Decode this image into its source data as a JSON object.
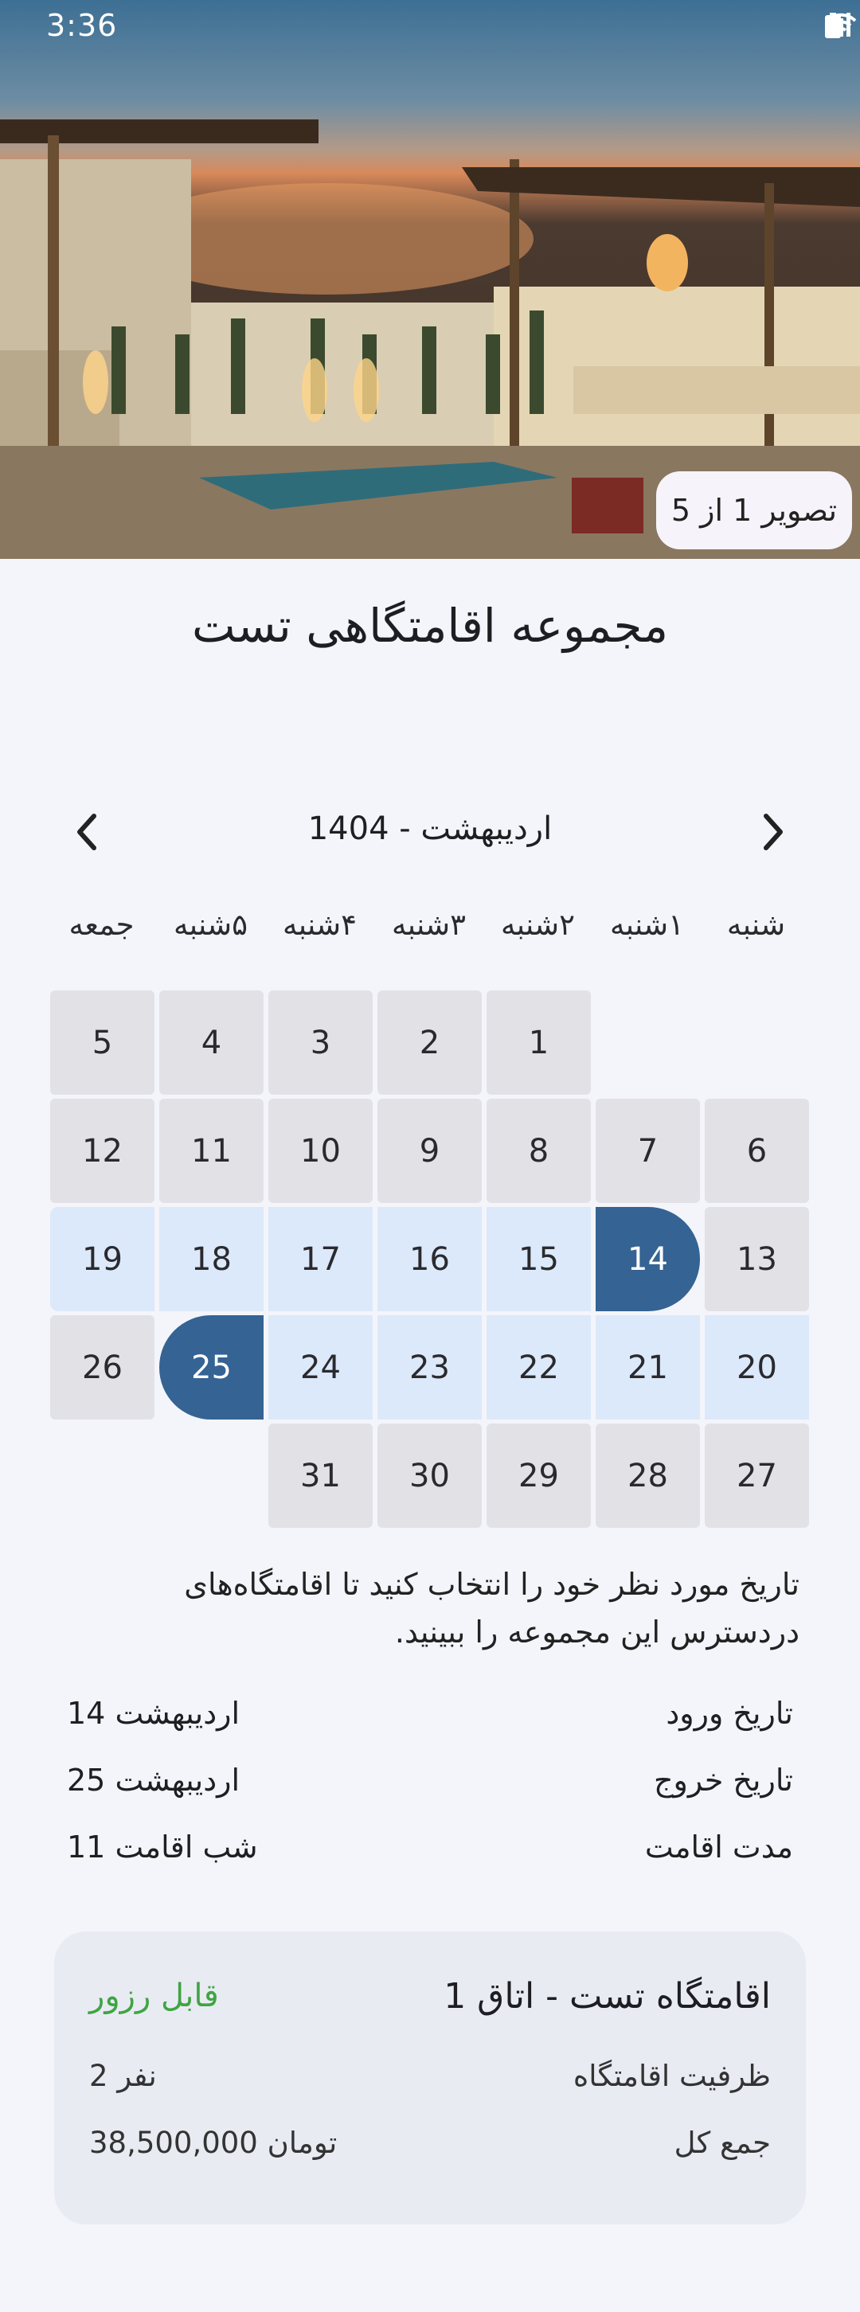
{
  "status_bar": {
    "time": "3:36"
  },
  "gallery": {
    "counter": "تصویر 1 از 5"
  },
  "title": "مجموعه اقامتگاهی تست",
  "calendar": {
    "month_label": "اردیبهشت - 1404",
    "weekdays": [
      "شنبه",
      "۱شنبه",
      "۲شنبه",
      "۳شنبه",
      "۴شنبه",
      "۵شنبه",
      "جمعه"
    ],
    "days": [
      "1",
      "2",
      "3",
      "4",
      "5",
      "6",
      "7",
      "8",
      "9",
      "10",
      "11",
      "12",
      "13",
      "14",
      "15",
      "16",
      "17",
      "18",
      "19",
      "20",
      "21",
      "22",
      "23",
      "24",
      "25",
      "26",
      "27",
      "28",
      "29",
      "30",
      "31"
    ],
    "check_in_day": 14,
    "check_out_day": 25,
    "colors": {
      "selected": "#356393",
      "range": "#dce9fa",
      "default": "#e2e2e6"
    }
  },
  "hint": "تاریخ مورد نظر خود را انتخاب کنید تا اقامتگاه‌های دردسترس این مجموعه را ببینید.",
  "summary": {
    "check_in_label": "تاریخ ورود",
    "check_in_value": "14 اردیبهشت",
    "check_out_label": "تاریخ خروج",
    "check_out_value": "25 اردیبهشت",
    "stay_label": "مدت اقامت",
    "stay_value": "11 شب اقامت"
  },
  "room_card": {
    "title": "اقامتگاه تست - اتاق 1",
    "status": "قابل رزور",
    "status_color": "#3fa542",
    "capacity_label": "ظرفیت اقامتگاه",
    "capacity_value": "2 نفر",
    "total_label": "جمع کل",
    "total_value": "38,500,000 تومان"
  }
}
